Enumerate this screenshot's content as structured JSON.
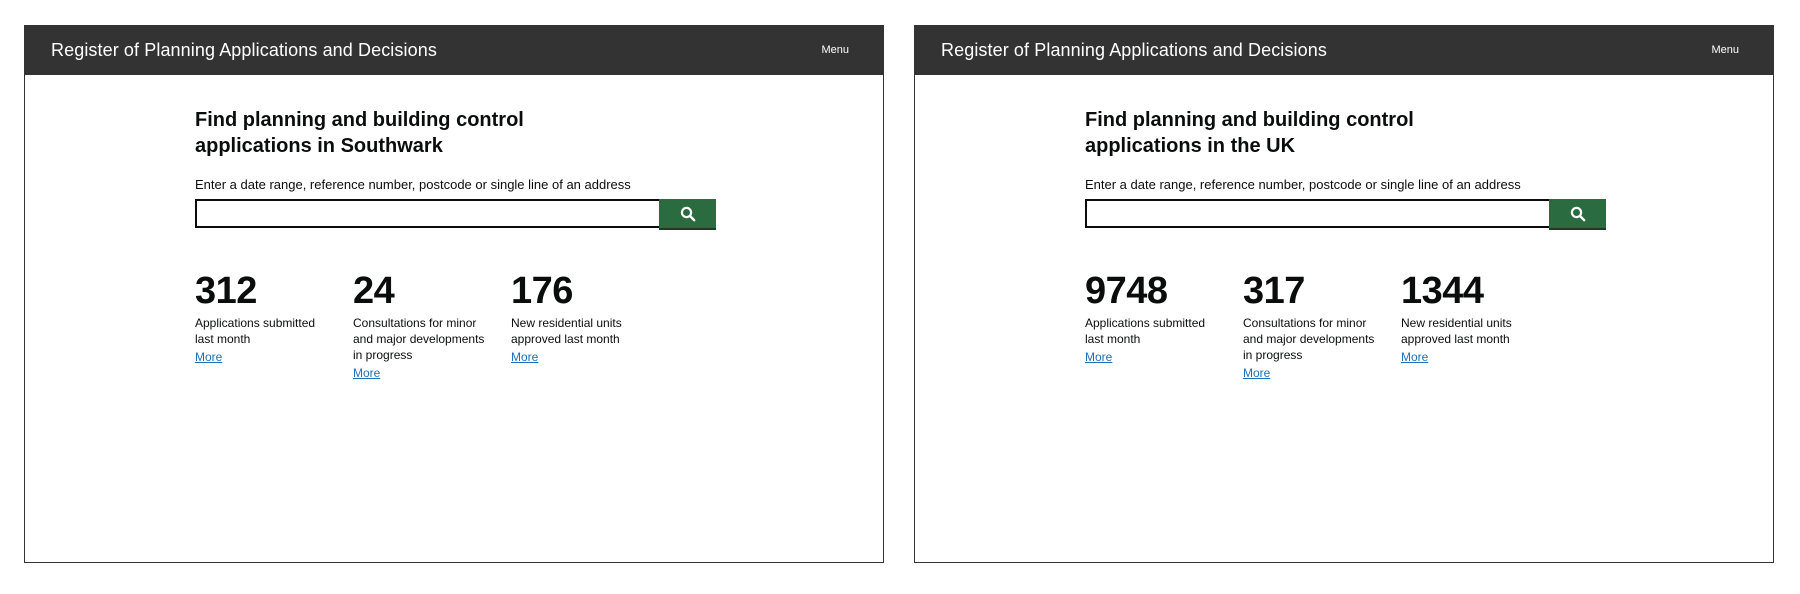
{
  "screens": [
    {
      "header": {
        "title": "Register of Planning Applications and Decisions",
        "menu_label": "Menu"
      },
      "heading": "Find planning and building control applications in Southwark",
      "search": {
        "hint": "Enter a date range, reference number, postcode or single line of an address",
        "value": "",
        "button_icon": "search-icon"
      },
      "stats": [
        {
          "number": "312",
          "label": "Applications submitted last month",
          "link": "More"
        },
        {
          "number": "24",
          "label": "Consultations for minor and major developments in progress",
          "link": "More"
        },
        {
          "number": "176",
          "label": "New residential units approved last month",
          "link": "More"
        }
      ]
    },
    {
      "header": {
        "title": "Register of Planning Applications and Decisions",
        "menu_label": "Menu"
      },
      "heading": "Find planning and building control applications in the UK",
      "search": {
        "hint": "Enter a date range, reference number, postcode or single line of an address",
        "value": "",
        "button_icon": "search-icon"
      },
      "stats": [
        {
          "number": "9748",
          "label": "Applications submitted last month",
          "link": "More"
        },
        {
          "number": "317",
          "label": "Consultations for minor and major developments in progress",
          "link": "More"
        },
        {
          "number": "1344",
          "label": "New residential units approved last month",
          "link": "More"
        }
      ]
    }
  ],
  "colors": {
    "header_bg": "#333333",
    "button_green": "#2b6b40",
    "link_blue": "#1d70b8"
  }
}
